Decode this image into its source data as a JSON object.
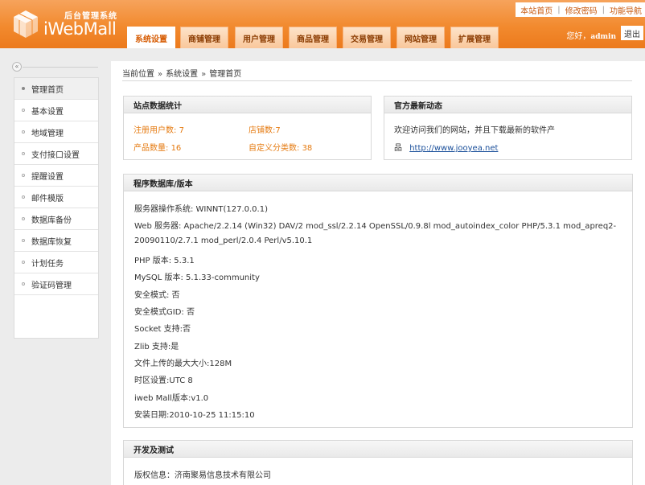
{
  "header": {
    "logo_subtitle": "后台管理系统",
    "logo_title": "iWebMall",
    "nav_tabs": [
      "系统设置",
      "商铺管理",
      "用户管理",
      "商品管理",
      "交易管理",
      "网站管理",
      "扩展管理"
    ],
    "top_links": [
      "本站首页",
      "修改密码",
      "功能导航"
    ],
    "welcome_prefix": "您好，",
    "username": "admin",
    "logout_label": "退出",
    "accent_color": "#f28a2e"
  },
  "sidebar": {
    "collapse_glyph": "«",
    "items": [
      "管理首页",
      "基本设置",
      "地域管理",
      "支付接口设置",
      "提醒设置",
      "邮件模版",
      "数据库备份",
      "数据库恢复",
      "计划任务",
      "验证码管理"
    ],
    "active_index": 0
  },
  "breadcrumb": {
    "items": [
      "当前位置",
      "系统设置",
      "管理首页"
    ],
    "separator": "»"
  },
  "stats_panel": {
    "title": "站点数据统计",
    "stats": [
      {
        "label": "注册用户数:",
        "value": "7"
      },
      {
        "label": "店铺数:",
        "value": "7"
      },
      {
        "label": "产品数量:",
        "value": "16"
      },
      {
        "label": "自定义分类数:",
        "value": "38"
      }
    ]
  },
  "news_panel": {
    "title": "官方最新动态",
    "text": "欢迎访问我们的网站，并且下载最新的软件产",
    "link_icon": "品",
    "link": "http://www.jooyea.net"
  },
  "version_panel": {
    "title": "程序数据库/版本",
    "lines": [
      "服务器操作系统: WINNT(127.0.0.1)",
      "Web 服务器: Apache/2.2.14 (Win32) DAV/2 mod_ssl/2.2.14 OpenSSL/0.9.8l mod_autoindex_color PHP/5.3.1 mod_apreq2-",
      "20090110/2.7.1 mod_perl/2.0.4 Perl/v5.10.1",
      "PHP 版本: 5.3.1",
      "MySQL 版本: 5.1.33-community",
      "安全模式: 否",
      "安全模式GID: 否",
      "Socket 支持:否",
      "Zlib 支持:是",
      "文件上传的最大大小:128M",
      "时区设置:UTC 8",
      "iweb Mall版本:v1.0",
      "安装日期:2010-10-25 11:15:10"
    ]
  },
  "dev_panel": {
    "title": "开发及测试",
    "copyright": "版权信息：济南聚易信息技术有限公司"
  }
}
